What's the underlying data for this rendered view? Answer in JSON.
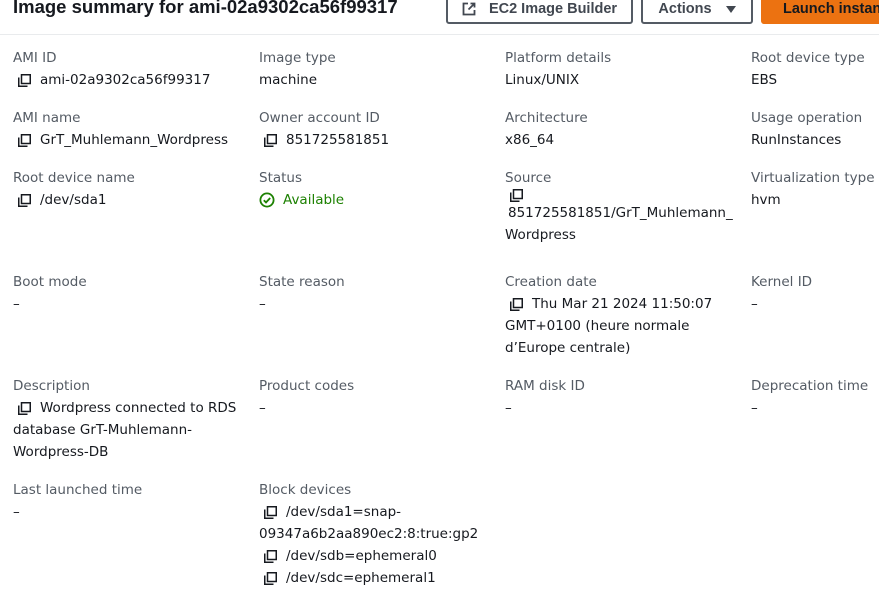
{
  "header": {
    "title": "Image summary for ami-02a9302ca56f99317",
    "builder_label": "EC2 Image Builder",
    "actions_label": "Actions",
    "launch_label": "Launch instance"
  },
  "fields": {
    "ami_id": {
      "label": "AMI ID",
      "value": "ami-02a9302ca56f99317"
    },
    "image_type": {
      "label": "Image type",
      "value": "machine"
    },
    "platform": {
      "label": "Platform details",
      "value": "Linux/UNIX"
    },
    "root_device_type": {
      "label": "Root device type",
      "value": "EBS"
    },
    "ami_name": {
      "label": "AMI name",
      "value": "GrT_Muhlemann_Wordpress"
    },
    "owner": {
      "label": "Owner account ID",
      "value": "851725581851"
    },
    "architecture": {
      "label": "Architecture",
      "value": "x86_64"
    },
    "usage": {
      "label": "Usage operation",
      "value": "RunInstances"
    },
    "root_device_name": {
      "label": "Root device name",
      "value": "/dev/sda1"
    },
    "status": {
      "label": "Status",
      "value": "Available"
    },
    "source": {
      "label": "Source",
      "lines": [
        "851725581851/GrT_Muhlemann_",
        "Wordpress"
      ]
    },
    "virtualization": {
      "label": "Virtualization type",
      "value": "hvm"
    },
    "boot_mode": {
      "label": "Boot mode",
      "value": "–"
    },
    "state_reason": {
      "label": "State reason",
      "value": "–"
    },
    "creation_date": {
      "label": "Creation date",
      "lines": [
        "Thu Mar 21 2024 11:50:07",
        "GMT+0100 (heure normale",
        "d’Europe centrale)"
      ]
    },
    "kernel_id": {
      "label": "Kernel ID",
      "value": "–"
    },
    "description": {
      "label": "Description",
      "lines": [
        "Wordpress connected to RDS",
        "database GrT-Muhlemann-",
        "Wordpress-DB"
      ]
    },
    "product_codes": {
      "label": "Product codes",
      "value": "–"
    },
    "ram_disk": {
      "label": "RAM disk ID",
      "value": "–"
    },
    "deprecation": {
      "label": "Deprecation time",
      "value": "–"
    },
    "last_launched": {
      "label": "Last launched time",
      "value": "–"
    },
    "block_devices": {
      "label": "Block devices",
      "lines": [
        "/dev/sda1=snap-",
        "09347a6b2aa890ec2:8:true:gp2",
        "/dev/sdb=ephemeral0",
        "/dev/sdc=ephemeral1"
      ]
    }
  },
  "icons": {
    "copy": "copy-icon",
    "external": "external-link-icon",
    "status": "check-circle-icon",
    "dropdown": "caret-down-icon"
  },
  "colors": {
    "accent": "#ec7211",
    "success": "#1d8102",
    "label": "#545b64",
    "text": "#16191f"
  }
}
